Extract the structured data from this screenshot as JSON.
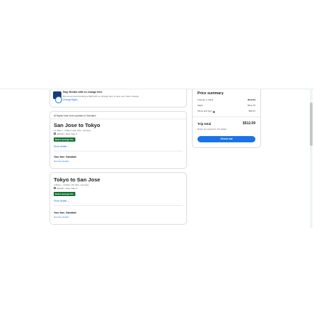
{
  "banner": {
    "title": "Stay flexible with no change fees",
    "description": "We recommend booking a flight with no change fees in case your plans change.",
    "link": "Change flights"
  },
  "notice": "All flights have been updated to Standard.",
  "flights": [
    {
      "route": "San Jose to Tokyo",
      "times": "11:45am – 3:50pm (11h 10m, nonstop)",
      "aircraft": "ZIPAIR • Wed, May 1",
      "emissions_badge": "Below average CO₂",
      "show_details": "Show details",
      "fare_label": "Your fare: Standard",
      "fare_link": "See fare details"
    },
    {
      "route": "Tokyo to San Jose",
      "times": "4:25pm – 9:40am (9h 15m, nonstop)",
      "aircraft": "ZIPAIR • Wed, May 8",
      "emissions_badge": "Below average CO₂",
      "show_details": "Show details",
      "fare_label": "Your fare: Standard",
      "fare_link": "See fare details"
    }
  ],
  "summary": {
    "title": "Price summary",
    "rows": [
      {
        "label": "Traveler 1: Adult",
        "value": "$512.09"
      },
      {
        "label": "Flight",
        "value": "$412.78"
      },
      {
        "label": "Taxes and fees",
        "value": "$99.31"
      }
    ],
    "total_label": "Trip total",
    "total_value": "$512.09",
    "note": "Rates are quoted in US dollars",
    "checkout_label": "Check out"
  },
  "colors": {
    "accent": "#1a73e8",
    "badge": "#137333",
    "border": "#dadce0"
  }
}
